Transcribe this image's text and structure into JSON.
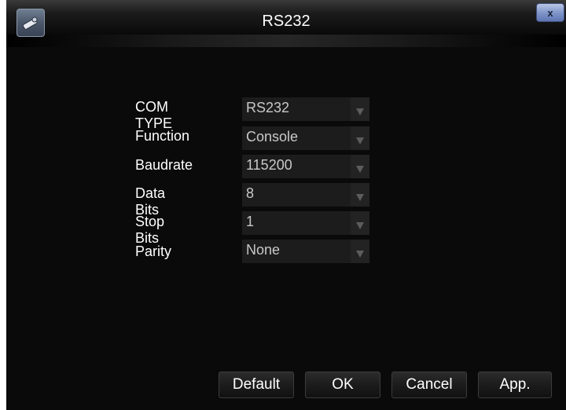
{
  "window": {
    "title": "RS232",
    "close_label": "x"
  },
  "form": {
    "rows": [
      {
        "label": "COM TYPE",
        "value": "RS232"
      },
      {
        "label": "Function",
        "value": "Console"
      },
      {
        "label": "Baudrate",
        "value": "115200"
      },
      {
        "label": "Data Bits",
        "value": "8"
      },
      {
        "label": "Stop Bits",
        "value": "1"
      },
      {
        "label": "Parity",
        "value": "None"
      }
    ]
  },
  "buttons": {
    "default": "Default",
    "ok": "OK",
    "cancel": "Cancel",
    "apply": "App."
  },
  "icons": {
    "app": "settings-tool-icon",
    "dropdown": "triangle-down-icon",
    "close": "close-icon"
  }
}
